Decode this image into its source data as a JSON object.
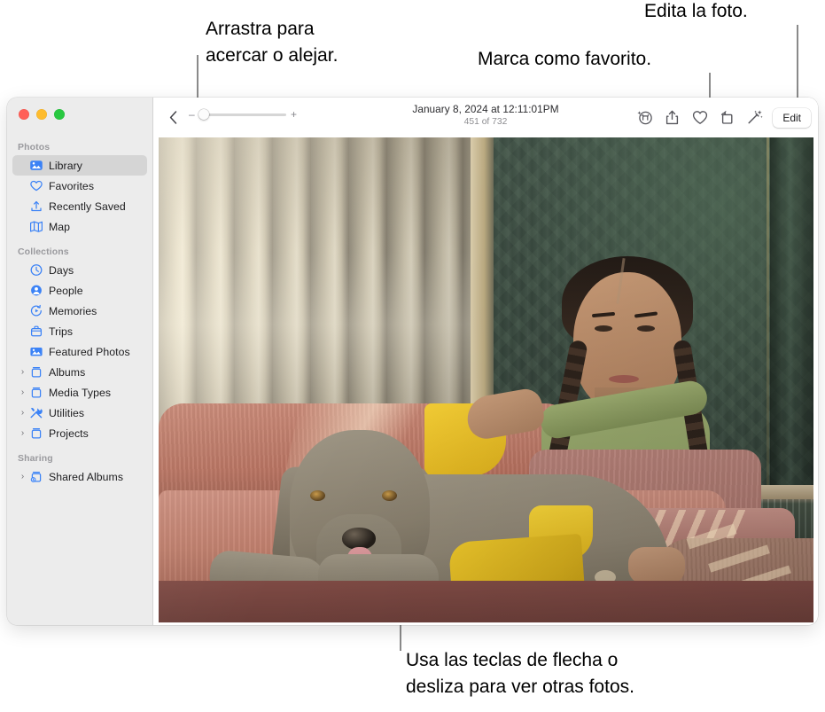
{
  "callouts": {
    "zoom": "Arrastra para\nacercar o alejar.",
    "favorite": "Marca como favorito.",
    "edit": "Edita la foto.",
    "swipe": "Usa las teclas de flecha o\ndesliza para ver otras fotos."
  },
  "window": {
    "traffic_lights": [
      "close",
      "minimize",
      "zoom"
    ]
  },
  "sidebar": {
    "sections": [
      {
        "title": "Photos",
        "items": [
          {
            "label": "Library",
            "icon": "photos-library-icon",
            "selected": true,
            "disclosure": false
          },
          {
            "label": "Favorites",
            "icon": "heart-icon",
            "selected": false,
            "disclosure": false
          },
          {
            "label": "Recently Saved",
            "icon": "recently-saved-icon",
            "selected": false,
            "disclosure": false
          },
          {
            "label": "Map",
            "icon": "map-icon",
            "selected": false,
            "disclosure": false
          }
        ]
      },
      {
        "title": "Collections",
        "items": [
          {
            "label": "Days",
            "icon": "clock-icon",
            "selected": false,
            "disclosure": false
          },
          {
            "label": "People",
            "icon": "person-icon",
            "selected": false,
            "disclosure": false
          },
          {
            "label": "Memories",
            "icon": "memories-play-icon",
            "selected": false,
            "disclosure": false
          },
          {
            "label": "Trips",
            "icon": "suitcase-icon",
            "selected": false,
            "disclosure": false
          },
          {
            "label": "Featured Photos",
            "icon": "featured-photo-icon",
            "selected": false,
            "disclosure": false
          },
          {
            "label": "Albums",
            "icon": "album-icon",
            "selected": false,
            "disclosure": true
          },
          {
            "label": "Media Types",
            "icon": "album-icon",
            "selected": false,
            "disclosure": true
          },
          {
            "label": "Utilities",
            "icon": "tools-icon",
            "selected": false,
            "disclosure": true
          },
          {
            "label": "Projects",
            "icon": "album-icon",
            "selected": false,
            "disclosure": true
          }
        ]
      },
      {
        "title": "Sharing",
        "items": [
          {
            "label": "Shared Albums",
            "icon": "shared-album-icon",
            "selected": false,
            "disclosure": true
          }
        ]
      }
    ]
  },
  "toolbar": {
    "back_label": "‹",
    "zoom_out_sign": "–",
    "zoom_in_sign": "+",
    "zoom_value": 0,
    "photo_date": "January 8, 2024 at 12:11:01PM",
    "photo_count": "451 of 732",
    "actions": [
      {
        "name": "info-pet-icon",
        "label": "Info"
      },
      {
        "name": "share-icon",
        "label": "Share"
      },
      {
        "name": "favorite-heart-icon",
        "label": "Favorite"
      },
      {
        "name": "rotate-icon",
        "label": "Rotate"
      },
      {
        "name": "auto-enhance-icon",
        "label": "Enhance"
      }
    ],
    "edit_label": "Edit"
  },
  "photo": {
    "description": "Girl with braids petting a Weimaraner dog on a rose-colored couch",
    "colors": {
      "couch": "#c07f6d",
      "wall": "#3e4f44",
      "blanket": "#d8ae1c",
      "dog": "#8a8170",
      "shirt": "#8c9d61",
      "overalls": "#b3745a"
    }
  }
}
